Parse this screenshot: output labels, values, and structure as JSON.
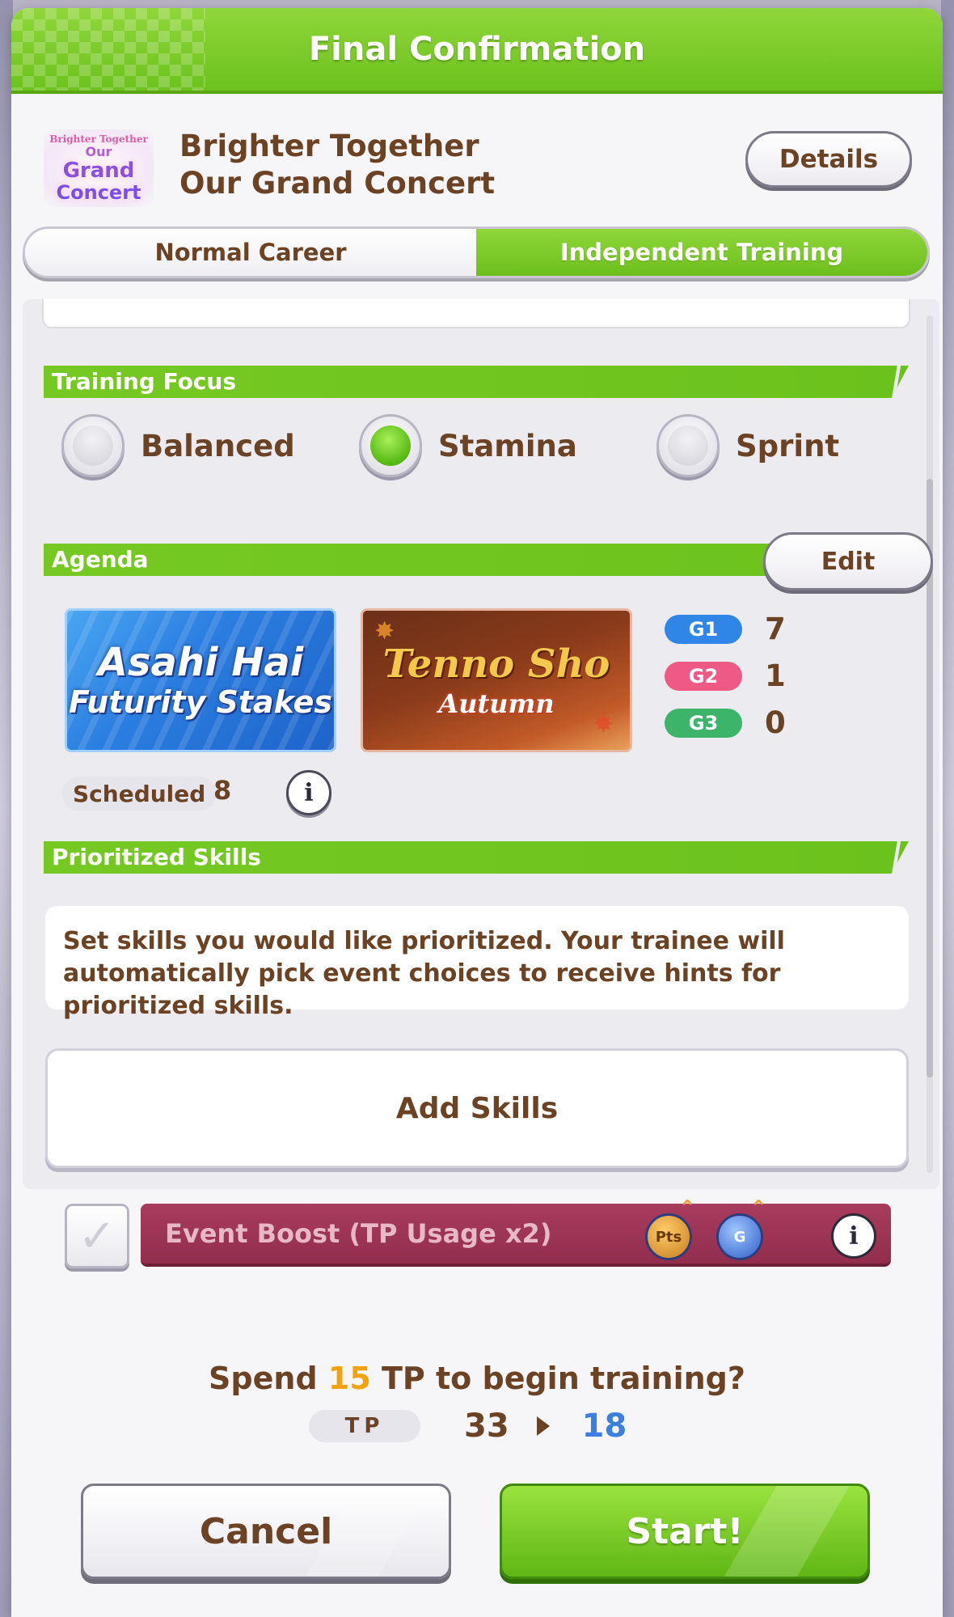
{
  "dialog": {
    "title": "Final Confirmation"
  },
  "event": {
    "logo_lines": [
      "Brighter Together",
      "Our",
      "Grand",
      "Concert"
    ],
    "name_line1": "Brighter Together",
    "name_line2": "Our Grand Concert",
    "details_label": "Details"
  },
  "tabs": [
    {
      "label": "Normal Career",
      "active": false
    },
    {
      "label": "Independent Training",
      "active": true
    }
  ],
  "training_focus": {
    "header": "Training Focus",
    "options": [
      {
        "label": "Balanced",
        "selected": false
      },
      {
        "label": "Stamina",
        "selected": true
      },
      {
        "label": "Sprint",
        "selected": false
      }
    ]
  },
  "agenda": {
    "header": "Agenda",
    "edit_label": "Edit",
    "races": [
      {
        "title_line1": "Asahi Hai",
        "title_line2": "Futurity Stakes"
      },
      {
        "title_line1": "Tenno Sho",
        "title_line2": "Autumn"
      }
    ],
    "grades": [
      {
        "label": "G1",
        "count": "7",
        "color": "#2f86e6"
      },
      {
        "label": "G2",
        "count": "1",
        "color": "#ee5a85"
      },
      {
        "label": "G3",
        "count": "0",
        "color": "#3cb46a"
      }
    ],
    "scheduled_label": "Scheduled",
    "scheduled_count": "8"
  },
  "prioritized_skills": {
    "header": "Prioritized Skills",
    "description": "Set skills you would like prioritized. Your trainee will automatically pick event choices to receive hints for prioritized skills.",
    "add_label": "Add Skills"
  },
  "event_boost": {
    "label": "Event Boost (TP Usage x2)",
    "checked": true,
    "icon_labels": [
      "Pts",
      "G"
    ]
  },
  "confirm": {
    "prefix": "Spend ",
    "cost": "15",
    "suffix": " TP to begin training?",
    "tp_label": "TP",
    "tp_current": "33",
    "tp_after": "18"
  },
  "buttons": {
    "cancel": "Cancel",
    "start": "Start!"
  }
}
